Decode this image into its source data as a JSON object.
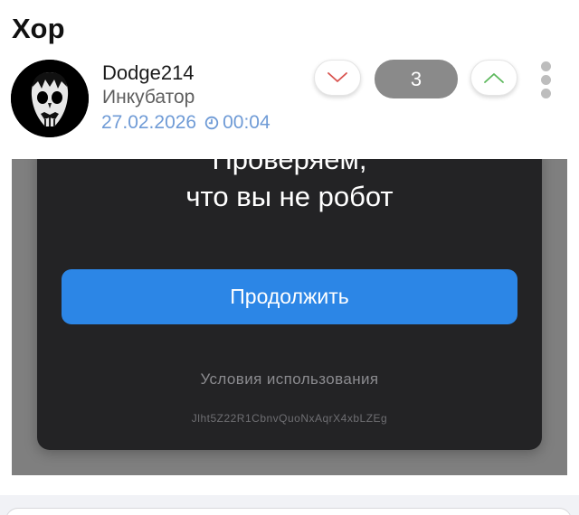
{
  "post": {
    "title": "Хор"
  },
  "author": {
    "name": "Dodge214",
    "community": "Инкубатор",
    "date": "27.02.2026",
    "time": "00:04"
  },
  "voting": {
    "rating": "3"
  },
  "captcha": {
    "title_line1": "Проверяем,",
    "title_line2": "что вы не робот",
    "continue_label": "Продолжить",
    "terms_label": "Условия использования",
    "request_id": "Jlht5Z22R1CbnvQuoNxAqrX4xbLZEg"
  },
  "colors": {
    "accent_blue": "#2c86e6",
    "meta_blue": "#6f9bd6",
    "downvote_red": "#d9534f",
    "upvote_green": "#5cb85c",
    "rating_gray": "#8a8a8a",
    "card_dark": "#232325"
  },
  "icons": {
    "downvote": "chevron-down-icon",
    "upvote": "chevron-up-icon",
    "clock": "clock-icon",
    "more": "more-vertical-icon"
  }
}
